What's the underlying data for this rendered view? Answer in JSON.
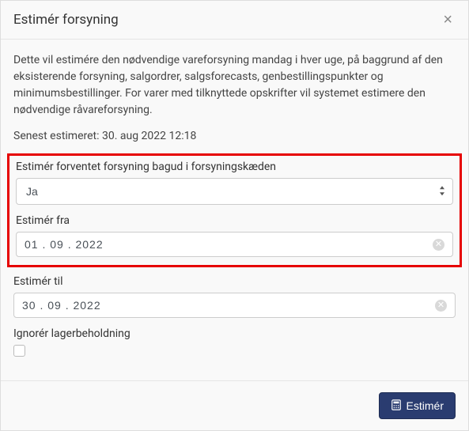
{
  "header": {
    "title": "Estimér forsyning",
    "close": "×"
  },
  "body": {
    "description": "Dette vil estimére den nødvendige vareforsyning mandag i hver uge, på baggrund af den eksisterende forsyning, salgordrer, salgsforecasts, genbestillingspunkter og minimumsbestillinger. For varer med tilknyttede opskrifter vil systemet estimere den nødvendige råvareforsyning.",
    "lastEstimated": "Senest estimeret: 30. aug 2022 12:18",
    "fields": {
      "backward": {
        "label": "Estimér forventet forsyning bagud i forsyningskæden",
        "value": "Ja"
      },
      "from": {
        "label": "Estimér fra",
        "value": "01 . 09 . 2022"
      },
      "to": {
        "label": "Estimér til",
        "value": "30 . 09 . 2022"
      },
      "ignoreStock": {
        "label": "Ignorér lagerbeholdning"
      }
    }
  },
  "footer": {
    "submit": "Estimér"
  }
}
